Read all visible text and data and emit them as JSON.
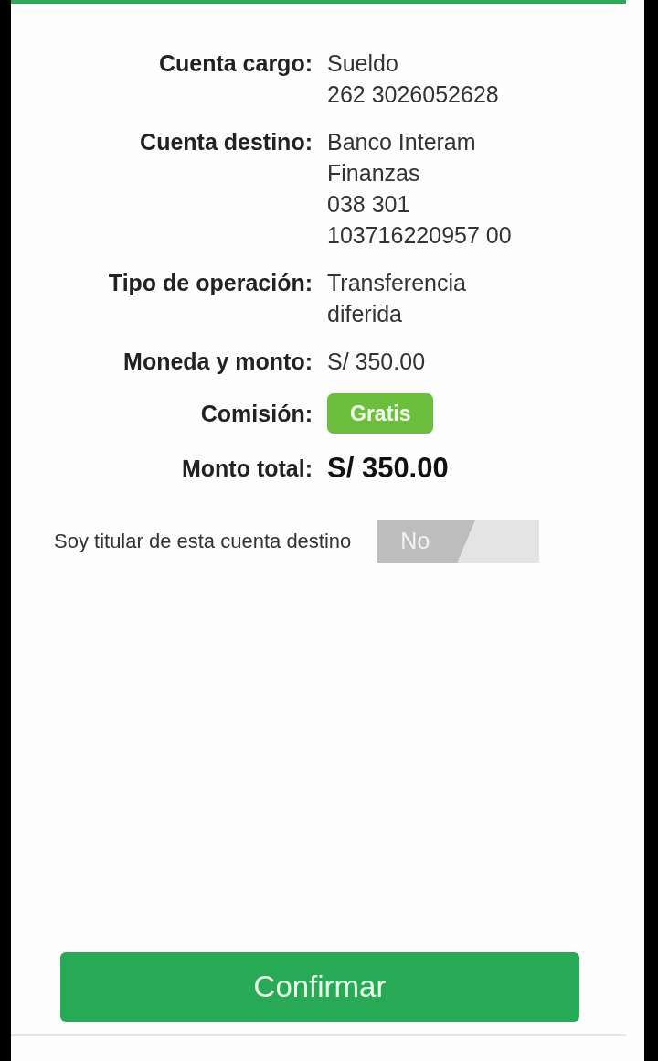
{
  "details": [
    {
      "label": "Cuenta cargo:",
      "kind": "text",
      "lines": [
        "Sueldo",
        "262 3026052628"
      ]
    },
    {
      "label": "Cuenta destino:",
      "kind": "text",
      "lines": [
        "Banco Interam",
        "Finanzas",
        "038 301",
        "103716220957 00"
      ]
    },
    {
      "label": "Tipo de operación:",
      "kind": "text",
      "lines": [
        "Transferencia",
        "diferida"
      ]
    },
    {
      "label": "Moneda y monto:",
      "kind": "text",
      "lines": [
        "S/ 350.00"
      ]
    },
    {
      "label": "Comisión:",
      "kind": "badge",
      "lines": [
        "Gratis"
      ]
    },
    {
      "label": "Monto total:",
      "kind": "total",
      "lines": [
        "S/ 350.00"
      ]
    }
  ],
  "owner_toggle": {
    "label": "Soy titular de esta cuenta destino",
    "on": false,
    "state_text": "No"
  },
  "confirm_button": "Confirmar"
}
